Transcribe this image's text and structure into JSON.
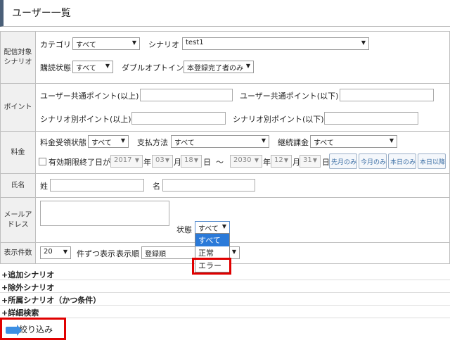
{
  "page_title": "ユーザー一覧",
  "delivery_target": {
    "label": "配信対象\nシナリオ",
    "category_label": "カテゴリ",
    "category_value": "すべて",
    "scenario_label": "シナリオ",
    "scenario_value": "test1",
    "subscription_label": "購読状態",
    "subscription_value": "すべて",
    "double_optin_label": "ダブルオプトイン",
    "double_optin_value": "本登録完了者のみ"
  },
  "points": {
    "label": "ポイント",
    "common_min_label": "ユーザー共通ポイント(以上)",
    "common_max_label": "ユーザー共通ポイント(以下)",
    "scenario_min_label": "シナリオ別ポイント(以上)",
    "scenario_max_label": "シナリオ別ポイント(以下)"
  },
  "fee": {
    "label": "料金",
    "payment_status_label": "料金受領状態",
    "payment_status_value": "すべて",
    "payment_method_label": "支払方法",
    "payment_method_value": "すべて",
    "recurring_label": "継続課金",
    "recurring_value": "すべて",
    "expiry_label": "有効期限終了日が",
    "from_year": "2017",
    "from_month": "03",
    "from_day": "18",
    "to_year": "2030",
    "to_month": "12",
    "to_day": "31",
    "year_unit": "年",
    "month_unit": "月",
    "day_unit": "日",
    "tilde": "～",
    "btn_last_month": "先月のみ",
    "btn_this_month": "今月のみ",
    "btn_today": "本日のみ",
    "btn_after_today": "本日以降"
  },
  "name": {
    "label": "氏名",
    "last_label": "姓",
    "first_label": "名"
  },
  "email": {
    "label": "メールア\nドレス",
    "status_label": "状態",
    "status_value": "すべて",
    "options": [
      "すべて",
      "正常",
      "エラー"
    ]
  },
  "display": {
    "label": "表示件数",
    "count_value": "20",
    "per_page_label": "件ずつ表示",
    "order_label": "表示順",
    "order_value": "登録順"
  },
  "sections": [
    "+追加シナリオ",
    "+除外シナリオ",
    "+所属シナリオ（かつ条件）",
    "+詳細検索"
  ],
  "filter_button": "絞り込み",
  "colors": {
    "highlight": "#2a7ad9",
    "annotation": "#e00000",
    "accent": "#3d8fe3"
  }
}
